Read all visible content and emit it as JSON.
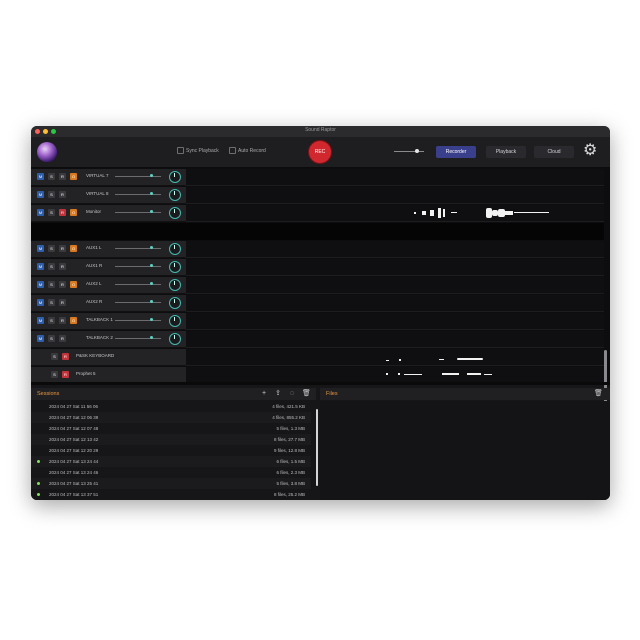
{
  "window": {
    "title": "Sound Raptor"
  },
  "toolbar": {
    "sync_playback": "Sync Playback",
    "auto_record": "Auto Record",
    "rec": "REC",
    "tabs": [
      "Recorder",
      "Playback",
      "Cloud"
    ],
    "active_tab": "Recorder"
  },
  "tracks": [
    {
      "name": "VIRTUAL 7",
      "buttons": [
        "M",
        "S",
        "R",
        "O"
      ],
      "level": 0.78
    },
    {
      "name": "VIRTUAL 8",
      "buttons": [
        "M",
        "S",
        "R"
      ],
      "level": 0.78
    },
    {
      "name": "Monitor",
      "buttons": [
        "M",
        "S",
        "R",
        "O"
      ],
      "level": 0.78
    },
    {
      "name": "AUX1 L",
      "buttons": [
        "M",
        "S",
        "R",
        "O"
      ],
      "level": 0.78
    },
    {
      "name": "AUX1 R",
      "buttons": [
        "M",
        "S",
        "R"
      ],
      "level": 0.78
    },
    {
      "name": "AUX2 L",
      "buttons": [
        "M",
        "S",
        "R",
        "O"
      ],
      "level": 0.78
    },
    {
      "name": "AUX2 R",
      "buttons": [
        "M",
        "S",
        "R"
      ],
      "level": 0.78
    },
    {
      "name": "TALKBACK 1",
      "buttons": [
        "M",
        "S",
        "R",
        "O"
      ],
      "level": 0.78
    },
    {
      "name": "TALKBACK 2",
      "buttons": [
        "M",
        "S",
        "R"
      ],
      "level": 0.78
    },
    {
      "name": "P&SK KEYBOARD",
      "buttons": [
        "S",
        "R"
      ]
    },
    {
      "name": "Prophet 5",
      "buttons": [
        "S",
        "R"
      ]
    }
  ],
  "sessions": {
    "header": "Sessions",
    "rows": [
      {
        "date": "2024 04 27 Sat  11 56 06",
        "info": "4 files, 421.5 KB",
        "dot": false
      },
      {
        "date": "2024 04 27 Sat  12 06 39",
        "info": "4 files, 855.2 KB",
        "dot": false
      },
      {
        "date": "2024 04 27 Sat  12 07 48",
        "info": "5 files, 1.3 MB",
        "dot": false
      },
      {
        "date": "2024 04 27 Sat  12 13 42",
        "info": "8 files, 27.7 MB",
        "dot": false
      },
      {
        "date": "2024 04 27 Sat  12 20 29",
        "info": "9 files, 12.8 MB",
        "dot": false
      },
      {
        "date": "2024 04 27 Sat  13 24 44",
        "info": "6 files, 1.5 MB",
        "dot": true
      },
      {
        "date": "2024 04 27 Sat  13 24 46",
        "info": "6 files, 2.3 MB",
        "dot": false
      },
      {
        "date": "2024 04 27 Sat  13 25 41",
        "info": "5 files, 3.8 MB",
        "dot": true
      },
      {
        "date": "2024 04 27 Sat  13 37 51",
        "info": "8 files, 25.2 MB",
        "dot": true
      }
    ]
  },
  "files": {
    "header": "Files"
  },
  "colors": {
    "accent": "#e7963b",
    "rec": "#d1282f",
    "mute": "#2f5fa8",
    "record": "#c0333a",
    "output": "#d77a1f",
    "knob": "#46b9b0",
    "active_tab": "#3a3f8c"
  }
}
